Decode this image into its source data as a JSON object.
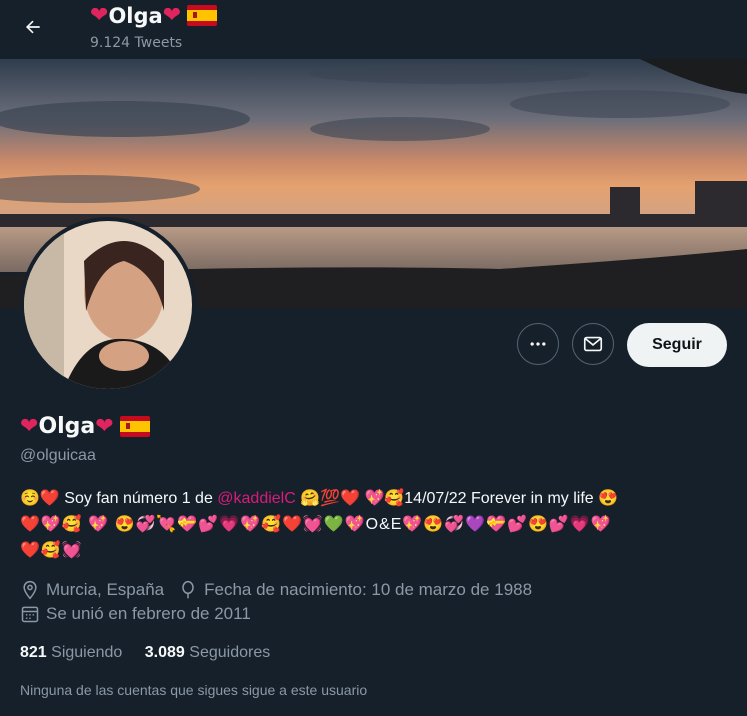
{
  "header": {
    "name": "Olga",
    "tweets_count": "9.124 Tweets"
  },
  "profile": {
    "name": "Olga",
    "handle": "@olguicaa",
    "bio_parts": {
      "text1": "Soy fan número 1 de ",
      "mention": "@kaddielC",
      "text2": "14/07/22 Forever in my life",
      "emoji_line1": "❤️💖🥰 💖 😍💞💘💝💕💗💖🥰❤️💓💚💖O&E💖😍💞💜💝💕😍💕💗💖",
      "emoji_line2": "❤️🥰💓"
    },
    "location": "Murcia, España",
    "birthday": "Fecha de nacimiento: 10 de marzo de 1988",
    "joined": "Se unió en febrero de 2011",
    "following_count": "821",
    "following_label": "Siguiendo",
    "followers_count": "3.089",
    "followers_label": "Seguidores",
    "followed_by_note": "Ninguna de las cuentas que sigues sigue a este usuario"
  },
  "actions": {
    "follow_label": "Seguir"
  },
  "icons": [
    "back-arrow-icon",
    "more-icon",
    "mail-icon",
    "location-icon",
    "balloon-icon",
    "calendar-icon"
  ],
  "colors": {
    "background": "#15202b",
    "accent_mention": "#d91c7c",
    "heart": "#e0245e",
    "secondary_text": "#8b98a5",
    "follow_button": "#eff3f4"
  }
}
